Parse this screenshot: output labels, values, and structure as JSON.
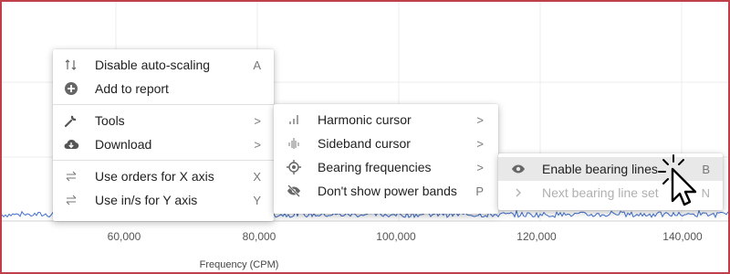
{
  "axis": {
    "tick_labels": [
      "60,000",
      "80,000",
      "100,000",
      "120,000",
      "140,000"
    ],
    "title": "Frequency (CPM)"
  },
  "menu_main": {
    "items": [
      {
        "icon": "auto-scaling-icon",
        "label": "Disable auto-scaling",
        "shortcut": "A"
      },
      {
        "icon": "add-circle-icon",
        "label": "Add to report",
        "shortcut": ""
      },
      {
        "icon": "wrench-icon",
        "label": "Tools",
        "shortcut": ">"
      },
      {
        "icon": "cloud-download-icon",
        "label": "Download",
        "shortcut": ">"
      },
      {
        "icon": "swap-arrows-icon",
        "label": "Use orders for X axis",
        "shortcut": "X"
      },
      {
        "icon": "swap-arrows-icon",
        "label": "Use in/s for Y axis",
        "shortcut": "Y"
      }
    ]
  },
  "menu_tools": {
    "items": [
      {
        "icon": "bar-chart-icon",
        "label": "Harmonic cursor",
        "shortcut": ">"
      },
      {
        "icon": "sideband-icon",
        "label": "Sideband cursor",
        "shortcut": ">"
      },
      {
        "icon": "target-icon",
        "label": "Bearing frequencies",
        "shortcut": ">"
      },
      {
        "icon": "eye-off-icon",
        "label": "Don't show power bands",
        "shortcut": "P"
      }
    ]
  },
  "menu_bearing": {
    "items": [
      {
        "icon": "eye-icon",
        "label": "Enable bearing lines",
        "shortcut": "B"
      },
      {
        "icon": "chevron-right-icon",
        "label": "Next bearing line set",
        "shortcut": "N"
      }
    ]
  }
}
